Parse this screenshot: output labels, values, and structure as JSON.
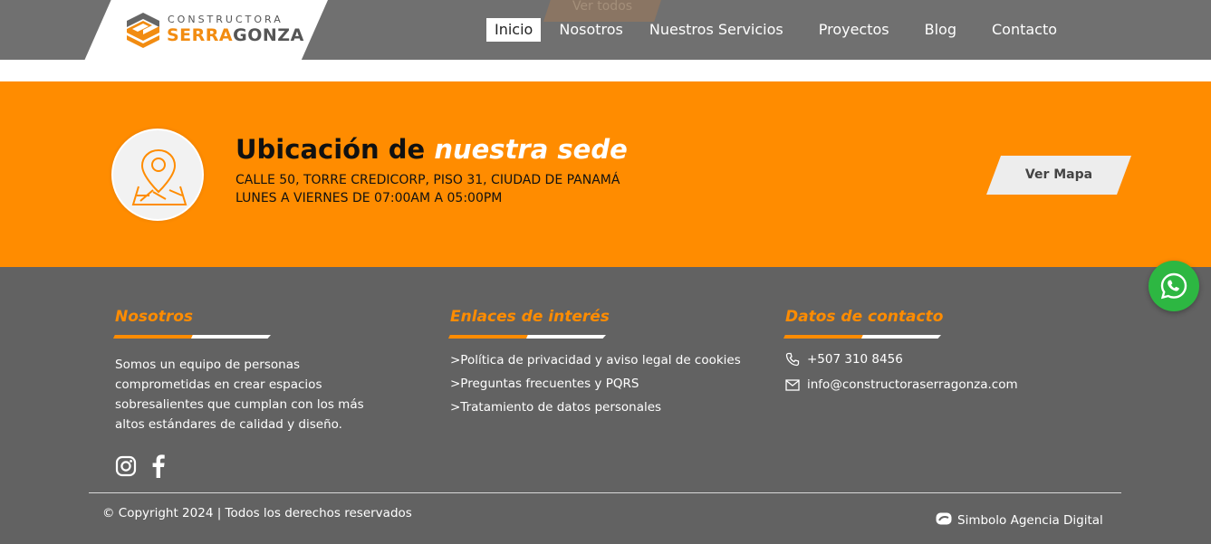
{
  "header": {
    "ghost_button": "Ver todos",
    "logo": {
      "top": "CONSTRUCTORA",
      "brand_a": "SERRA",
      "brand_b": "GONZA"
    },
    "nav": [
      "Inicio",
      "Nosotros",
      "Nuestros Servicios",
      "Proyectos",
      "Blog",
      "Contacto"
    ],
    "active_nav": "Inicio"
  },
  "location": {
    "title_plain": "Ubicación de",
    "title_emphasis": "nuestra sede",
    "address": "CALLE 50, TORRE CREDICORP, PISO 31, CIUDAD DE PANAMÁ",
    "hours": "LUNES A VIERNES DE 07:00AM A 05:00PM",
    "map_button": "Ver Mapa",
    "icon": "map-pin-icon"
  },
  "footer": {
    "about": {
      "title": "Nosotros",
      "text": "Somos un equipo de personas comprometidas en crear espacios sobresalientes que cumplan con los más altos estándares de calidad y diseño.",
      "social": [
        "instagram-icon",
        "facebook-icon"
      ]
    },
    "links": {
      "title": "Enlaces de interés",
      "items": [
        ">Política de privacidad y aviso legal de cookies",
        ">Preguntas frecuentes y PQRS",
        ">Tratamiento de datos personales"
      ]
    },
    "contact": {
      "title": "Datos de contacto",
      "phone": "+507 310 8456",
      "email": "info@constructoraserragonza.com"
    },
    "copyright": "© Copyright 2024 | Todos los derechos reservados",
    "agency": "Simbolo Agencia Digital"
  },
  "colors": {
    "accent": "#ff8c00",
    "header_bg": "#707070",
    "footer_bg": "#626262",
    "whatsapp": "#2db742"
  }
}
